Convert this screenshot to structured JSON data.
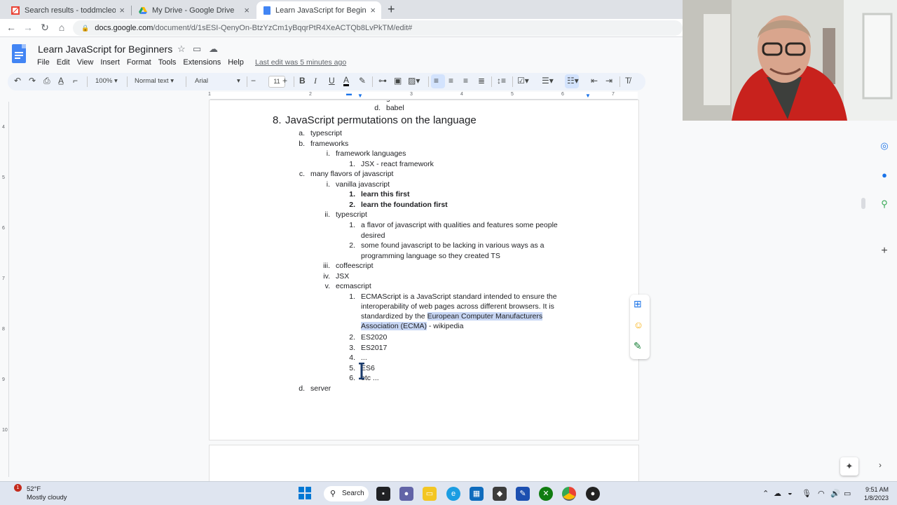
{
  "browser": {
    "tabs": [
      {
        "label": "Search results - toddmcleod@gmail",
        "icon": "gmail-icon",
        "active": false
      },
      {
        "label": "My Drive - Google Drive",
        "icon": "drive-icon",
        "active": false
      },
      {
        "label": "Learn JavaScript for Beginners - Go",
        "icon": "docs-icon",
        "active": true
      }
    ],
    "new_tab": "+",
    "url_host": "docs.google.com",
    "url_path": "/document/d/1sESI-QenyOn-BtzYzCm1yBqqrPtR4XeACTQb8LvPkTM/edit#"
  },
  "docs": {
    "title": "Learn JavaScript for Beginners",
    "menu": [
      "File",
      "Edit",
      "View",
      "Insert",
      "Format",
      "Tools",
      "Extensions",
      "Help"
    ],
    "last_edit": "Last edit was 5 minutes ago",
    "toolbar": {
      "zoom": "100%",
      "style": "Normal text",
      "font": "Arial",
      "font_size": "11"
    },
    "ruler_numbers": [
      "1",
      "2",
      "3",
      "4",
      "5",
      "6",
      "7"
    ],
    "vruler_numbers": [
      "4",
      "5",
      "6",
      "7",
      "8",
      "9",
      "10"
    ]
  },
  "document": {
    "top_partial": {
      "marker": "c.",
      "text": "grunt"
    },
    "top_item": {
      "marker": "d.",
      "text": "babel"
    },
    "heading": {
      "marker": "8.",
      "text": "JavaScript permutations on the language"
    },
    "lines": [
      {
        "marker": "a.",
        "text": "typescript",
        "level": 1
      },
      {
        "marker": "b.",
        "text": "frameworks",
        "level": 1
      },
      {
        "marker": "i.",
        "text": "framework languages",
        "level": 2
      },
      {
        "marker": "1.",
        "text": "JSX - react framework",
        "level": 3
      },
      {
        "marker": "c.",
        "text": "many flavors of javascript",
        "level": 1
      },
      {
        "marker": "i.",
        "text": "vanilla javascript",
        "level": 2
      },
      {
        "marker": "1.",
        "text": "learn this first",
        "level": 3,
        "bold": true
      },
      {
        "marker": "2.",
        "text": "learn the foundation first",
        "level": 3,
        "bold": true
      },
      {
        "marker": "ii.",
        "text": "typescript",
        "level": 2
      },
      {
        "marker": "1.",
        "text": "a flavor of javascript with qualities and features some people",
        "level": 3
      },
      {
        "marker": "",
        "text": "desired",
        "level": 3
      },
      {
        "marker": "2.",
        "text": "some found javascript to be lacking in various ways as a",
        "level": 3
      },
      {
        "marker": "",
        "text": "programming language so they created TS",
        "level": 3
      },
      {
        "marker": "iii.",
        "text": "coffeescript",
        "level": 2
      },
      {
        "marker": "iv.",
        "text": "JSX",
        "level": 2
      },
      {
        "marker": "v.",
        "text": "ecmascript",
        "level": 2
      },
      {
        "marker": "1.",
        "text": "ECMAScript is a JavaScript standard intended to ensure the",
        "level": 3
      },
      {
        "marker": "",
        "text": "interoperability of web pages across different browsers. It is",
        "level": 3
      }
    ],
    "ecma_line3_plain": "standardized by the ",
    "ecma_line3_hl": "European Computer Manufacturers",
    "ecma_line4_hl": "Association (ECMA)",
    "ecma_line4_plain": " - wikipedia",
    "lines_after": [
      {
        "marker": "2.",
        "text": "ES2020",
        "level": 3
      },
      {
        "marker": "3.",
        "text": "ES2017",
        "level": 3
      },
      {
        "marker": "4.",
        "text": "...",
        "level": 3
      },
      {
        "marker": "5.",
        "text": "ES6",
        "level": 3
      },
      {
        "marker": "6.",
        "text": "etc ...",
        "level": 3
      },
      {
        "marker": "d.",
        "text": "server",
        "level": 1
      }
    ]
  },
  "taskbar": {
    "weather_temp": "52°F",
    "weather_desc": "Mostly cloudy",
    "notification_count": "1",
    "search_label": "Search",
    "time": "9:51 AM",
    "date": "1/8/2023"
  },
  "colors": {
    "accent": "#1a73e8",
    "docs_blue": "#4285f4",
    "highlight": "#c8d7f5"
  }
}
